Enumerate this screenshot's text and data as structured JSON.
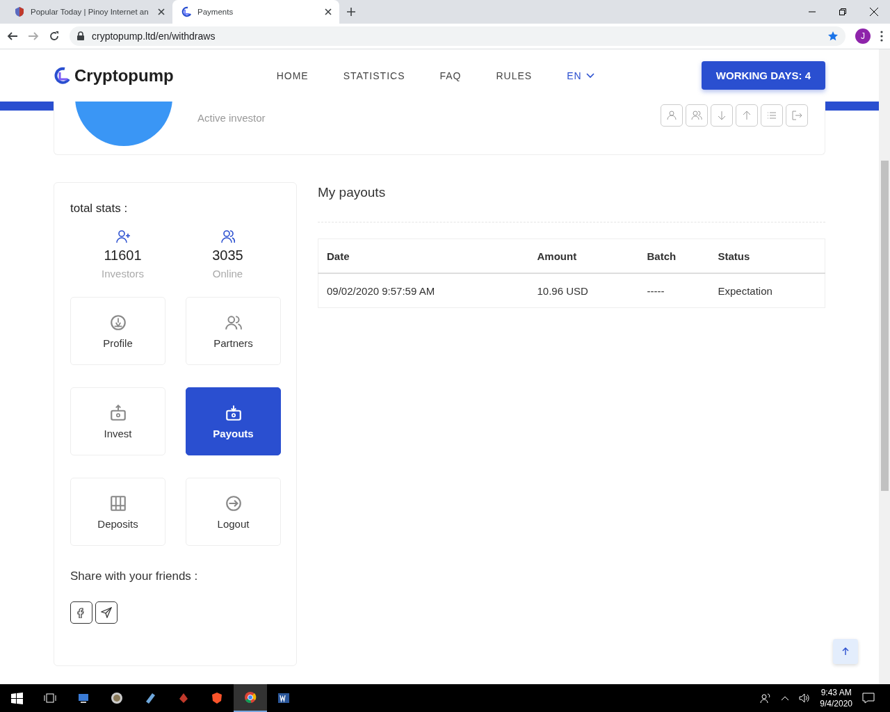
{
  "browser": {
    "tabs": [
      {
        "title": "Popular Today | Pinoy Internet an",
        "selected": false
      },
      {
        "title": "Payments",
        "selected": true
      }
    ],
    "url": "cryptopump.ltd/en/withdraws",
    "account_initial": "J"
  },
  "header": {
    "logo": "Cryptopump",
    "nav": [
      {
        "label": "HOME",
        "kind": "link"
      },
      {
        "label": "STATISTICS",
        "kind": "link"
      },
      {
        "label": "FAQ",
        "kind": "link"
      },
      {
        "label": "RULES",
        "kind": "link"
      },
      {
        "label": "EN",
        "kind": "dropdown"
      }
    ],
    "working_days": "WORKING DAYS: 4"
  },
  "profile": {
    "status": "Active investor"
  },
  "sidebar": {
    "title": "total stats :",
    "stats": [
      {
        "value": "11601",
        "label": "Investors"
      },
      {
        "value": "3035",
        "label": "Online"
      }
    ],
    "menu": [
      {
        "label": "Profile",
        "selected": false
      },
      {
        "label": "Partners",
        "selected": false
      },
      {
        "label": "Invest",
        "selected": false
      },
      {
        "label": "Payouts",
        "selected": true
      },
      {
        "label": "Deposits",
        "selected": false
      },
      {
        "label": "Logout",
        "selected": false
      }
    ],
    "share_title": "Share with your friends :"
  },
  "payouts": {
    "title": "My payouts",
    "columns": [
      "Date",
      "Amount",
      "Batch",
      "Status"
    ],
    "rows": [
      [
        "09/02/2020 9:57:59 AM",
        "10.96 USD",
        "-----",
        "Expectation"
      ]
    ]
  },
  "taskbar": {
    "time": "9:43 AM",
    "date": "9/4/2020"
  }
}
